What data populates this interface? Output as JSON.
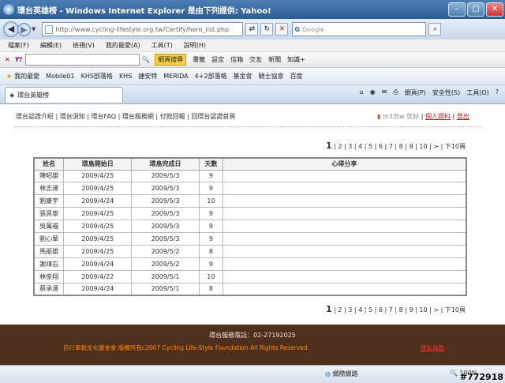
{
  "window": {
    "title": "環台英雄榜 - Windows Internet Explorer 是由下列提供: Yahoo!"
  },
  "address": {
    "url": "http://www.cycling-lifestyle.org.tw/Certify/hero_list.php",
    "search_placeholder": "Google"
  },
  "menu": [
    "檔案(F)",
    "編輯(E)",
    "檢視(V)",
    "我的最愛(A)",
    "工具(T)",
    "說明(H)"
  ],
  "yahoo_toolbar": {
    "search_button": "網頁搜尋",
    "items": [
      "書籤",
      "設定",
      "信箱",
      "交友",
      "新聞",
      "知識+"
    ]
  },
  "favorites_bar": {
    "label": "我的最愛",
    "items": [
      "Mobile01",
      "KHS部落格",
      "KHS",
      "捷安特",
      "MERIDA",
      "4+2部落格",
      "基金會",
      "騎士協會",
      "百度"
    ]
  },
  "tab": {
    "title": "環台英雄榜"
  },
  "command_bar": [
    "網頁(P)",
    "安全性(S)",
    "工具(O)"
  ],
  "site_nav": {
    "text": "環台認證介紹 | 環台須知 | 環台FAQ | 環台服務網 | 付款回報 | 回環台認證首頁"
  },
  "user": {
    "greeting": "m33tw 您好",
    "profile": "個人資料",
    "logout": "登出"
  },
  "pager": {
    "current": "1",
    "pages": "| 2 | 3 | 4 | 5 | 6 | 7 | 8 | 9 | 10 | > | 下10頁"
  },
  "table": {
    "headers": [
      "姓名",
      "環島開始日",
      "環島完成日",
      "天數",
      "心得分享"
    ],
    "rows": [
      [
        "陳昭雄",
        "2009/4/25",
        "2009/5/3",
        "9",
        ""
      ],
      [
        "林志達",
        "2009/4/25",
        "2009/5/3",
        "9",
        ""
      ],
      [
        "劉康宇",
        "2009/4/24",
        "2009/5/3",
        "10",
        ""
      ],
      [
        "張晁寧",
        "2009/4/25",
        "2009/5/3",
        "9",
        ""
      ],
      [
        "吳萬福",
        "2009/4/25",
        "2009/5/3",
        "9",
        ""
      ],
      [
        "劉心華",
        "2009/4/25",
        "2009/5/3",
        "9",
        ""
      ],
      [
        "馬振雄",
        "2009/4/25",
        "2009/5/2",
        "8",
        ""
      ],
      [
        "謝靖右",
        "2009/4/24",
        "2009/5/2",
        "9",
        ""
      ],
      [
        "林俊翔",
        "2009/4/22",
        "2009/5/1",
        "10",
        ""
      ],
      [
        "蔡承達",
        "2009/4/24",
        "2009/5/1",
        "8",
        ""
      ]
    ]
  },
  "footer": {
    "phone": "環台服務電話：02-27192025",
    "copyright": "自行車新文化基金會 版權所有c2007 Cycling Life-Style Foundation All Rights Reserved.",
    "privacy": "隱私條款"
  },
  "status": {
    "zone": "網際網路",
    "zoom": "100%"
  },
  "watermark": "#772918"
}
